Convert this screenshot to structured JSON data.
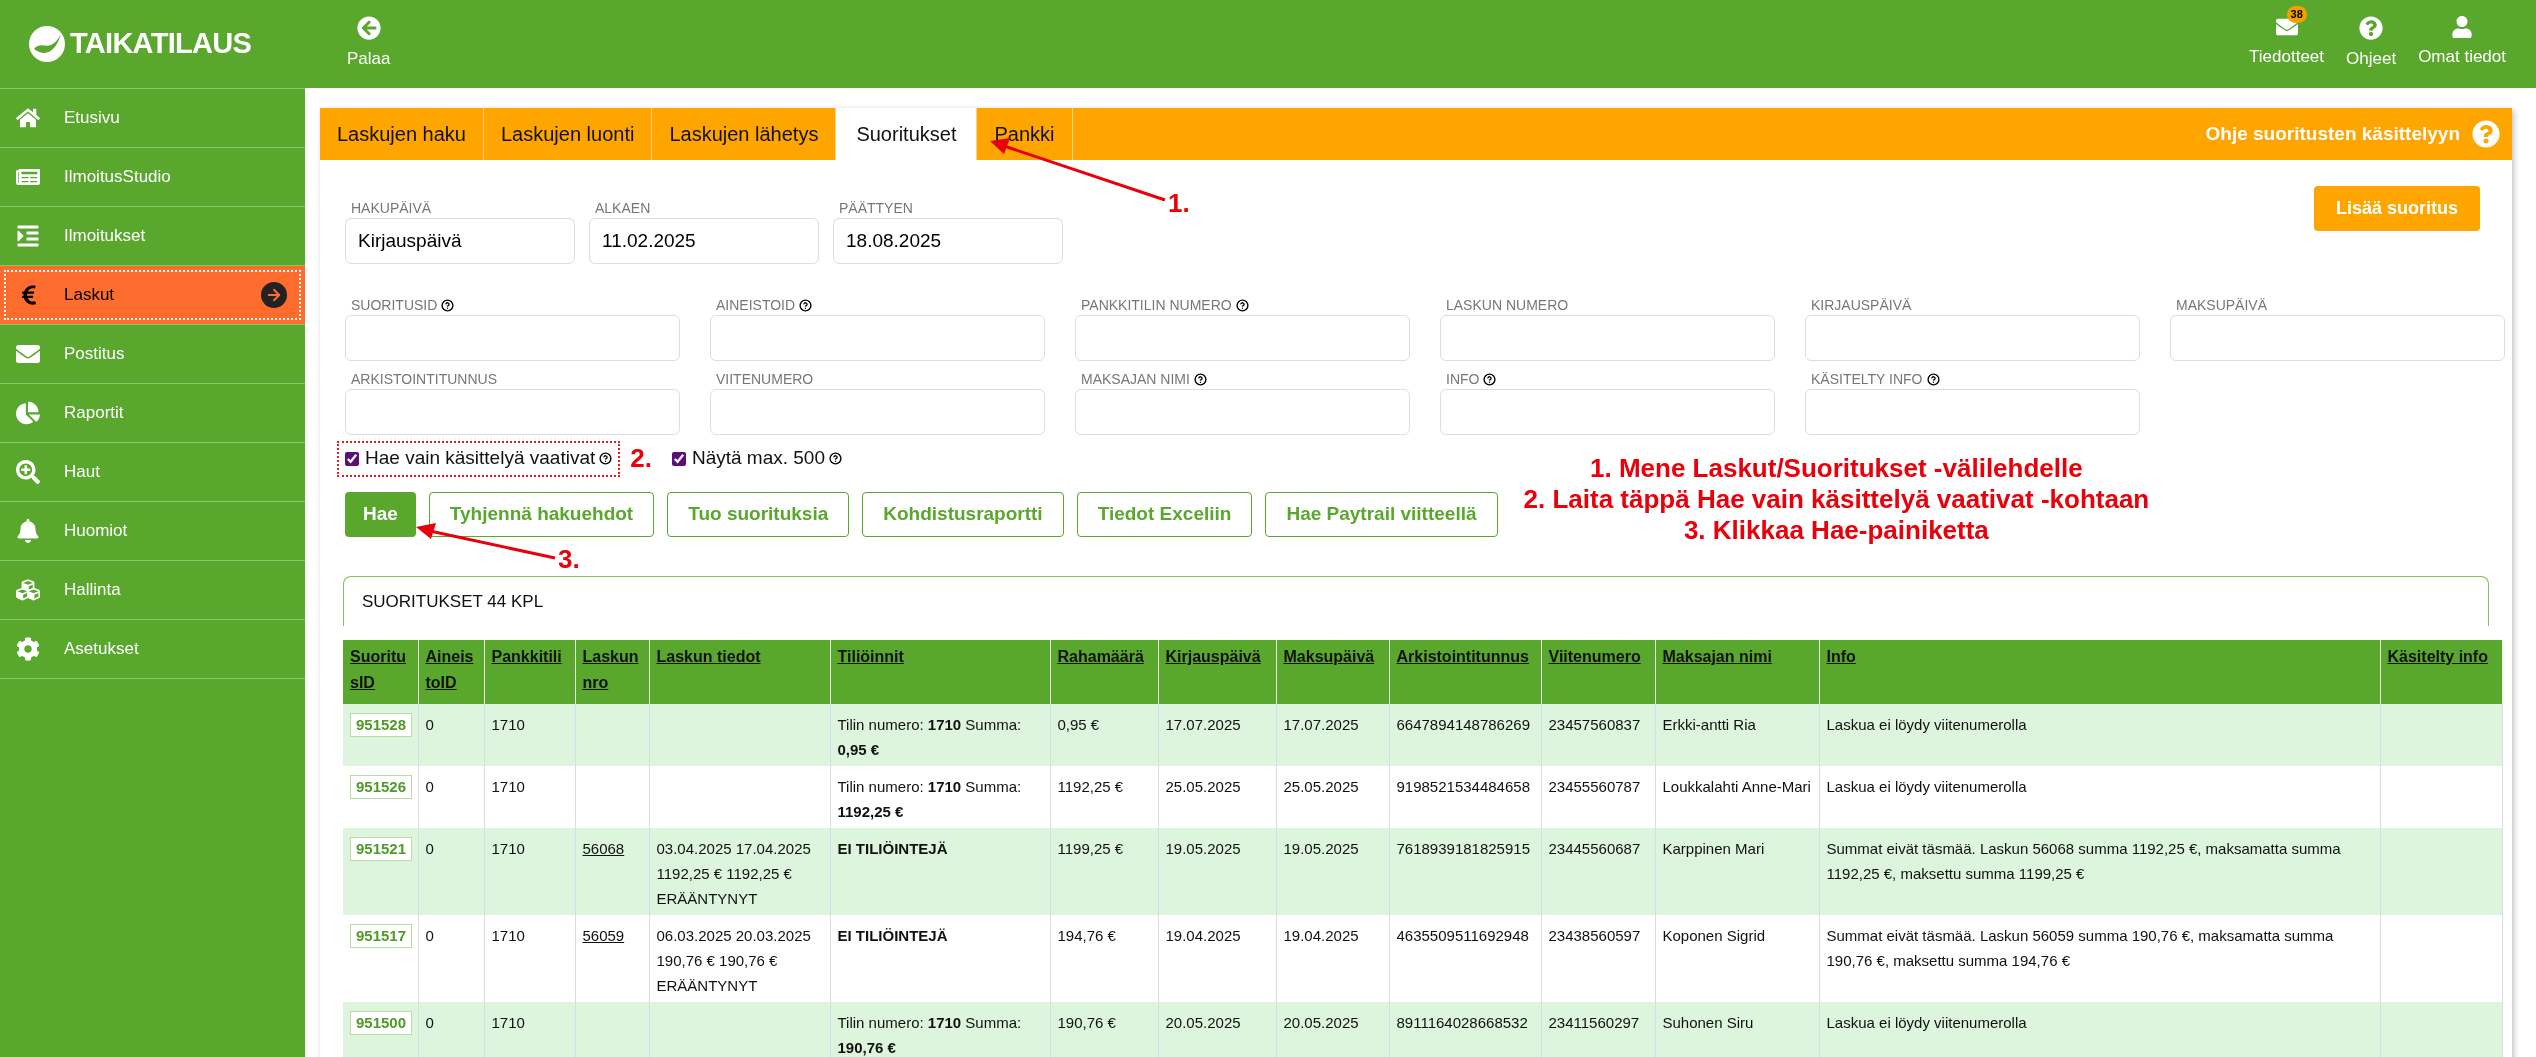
{
  "header": {
    "logo": "TAIKATILAUS",
    "back": "Palaa",
    "nav": [
      {
        "label": "Tiedotteet",
        "badge": "38"
      },
      {
        "label": "Ohjeet"
      },
      {
        "label": "Omat tiedot"
      }
    ]
  },
  "sidebar": {
    "items": [
      {
        "label": "Etusivu",
        "selected": false
      },
      {
        "label": "IlmoitusStudio",
        "selected": false
      },
      {
        "label": "Ilmoitukset",
        "selected": false
      },
      {
        "label": "Laskut",
        "selected": true
      },
      {
        "label": "Postitus",
        "selected": false
      },
      {
        "label": "Raportit",
        "selected": false
      },
      {
        "label": "Haut",
        "selected": false
      },
      {
        "label": "Huomiot",
        "selected": false
      },
      {
        "label": "Hallinta",
        "selected": false
      },
      {
        "label": "Asetukset",
        "selected": false
      }
    ]
  },
  "tabs": [
    {
      "label": "Laskujen haku",
      "selected": false
    },
    {
      "label": "Laskujen luonti",
      "selected": false
    },
    {
      "label": "Laskujen lähetys",
      "selected": false
    },
    {
      "label": "Suoritukset",
      "selected": true
    },
    {
      "label": "Pankki",
      "selected": false
    }
  ],
  "help_link": "Ohje suoritusten käsittelyyn",
  "date_fields": [
    {
      "label": "HAKUPÄIVÄ",
      "value": "Kirjauspäivä"
    },
    {
      "label": "ALKAEN",
      "value": "11.02.2025"
    },
    {
      "label": "PÄÄTTYEN",
      "value": "18.08.2025"
    }
  ],
  "add_button": "Lisää suoritus",
  "filters": [
    {
      "label": "SUORITUSID",
      "help": true
    },
    {
      "label": "AINEISTOID",
      "help": true
    },
    {
      "label": "PANKKITILIN NUMERO",
      "help": true
    },
    {
      "label": "LASKUN NUMERO",
      "help": false
    },
    {
      "label": "KIRJAUSPÄIVÄ",
      "help": false
    },
    {
      "label": "MAKSUPÄIVÄ",
      "help": false
    },
    {
      "label": "ARKISTOINTITUNNUS",
      "help": false
    },
    {
      "label": "VIITENUMERO",
      "help": false
    },
    {
      "label": "MAKSAJAN NIMI",
      "help": true
    },
    {
      "label": "INFO",
      "help": true
    },
    {
      "label": "KÄSITELTY INFO",
      "help": true
    }
  ],
  "checkboxes": [
    {
      "label": "Hae vain käsittelyä vaativat",
      "checked": true,
      "help": true,
      "highlighted": true
    },
    {
      "label": "Näytä max. 500",
      "checked": true,
      "help": true,
      "highlighted": false
    }
  ],
  "buttons": [
    {
      "label": "Hae",
      "kind": "primary"
    },
    {
      "label": "Tyhjennä hakuehdot",
      "kind": "outline"
    },
    {
      "label": "Tuo suorituksia",
      "kind": "outline"
    },
    {
      "label": "Kohdistusraportti",
      "kind": "outline"
    },
    {
      "label": "Tiedot Exceliin",
      "kind": "outline"
    },
    {
      "label": "Hae Paytrail viitteellä",
      "kind": "outline"
    }
  ],
  "annotations": {
    "markers": [
      "1.",
      "2.",
      "3."
    ],
    "steps": [
      "1. Mene Laskut/Suoritukset -välilehdelle",
      "2. Laita täppä Hae vain käsittelyä vaativat -kohtaan",
      "3. Klikkaa Hae-painiketta"
    ]
  },
  "table": {
    "title": "SUORITUKSET 44 KPL",
    "columns": [
      "SuoritusID",
      "AineistoID",
      "Pankkitili",
      "Laskun nro",
      "Laskun tiedot",
      "Tiliöinnit",
      "Rahamäärä",
      "Kirjauspäivä",
      "Maksupäivä",
      "Arkistointitunnus",
      "Viitenumero",
      "Maksajan nimi",
      "Info",
      "Käsitelty info"
    ],
    "rows": [
      {
        "suoritusid": "951528",
        "aineistoid": "0",
        "pankkitili": "1710",
        "tilioinnit": {
          "kind": "entry",
          "text": "Tilin numero: **1710** Summa: **0,95 €**"
        },
        "rahamaara": "0,95 €",
        "kirjauspaiva": "17.07.2025",
        "maksupaiva": "17.07.2025",
        "arkistointitunnus": "6647894148786269",
        "viitenumero": "23457560837",
        "maksaja": "Erkki-antti Ria",
        "info": "Laskua ei löydy viitenumerolla"
      },
      {
        "suoritusid": "951526",
        "aineistoid": "0",
        "pankkitili": "1710",
        "tilioinnit": {
          "kind": "entry",
          "text": "Tilin numero: **1710** Summa: **1192,25 €**"
        },
        "rahamaara": "1192,25 €",
        "kirjauspaiva": "25.05.2025",
        "maksupaiva": "25.05.2025",
        "arkistointitunnus": "9198521534484658",
        "viitenumero": "23455560787",
        "maksaja": "Loukkalahti Anne-Mari",
        "info": "Laskua ei löydy viitenumerolla"
      },
      {
        "suoritusid": "951521",
        "aineistoid": "0",
        "pankkitili": "1710",
        "laskun_nro": "56068",
        "laskun_tiedot": "03.04.2025 17.04.2025 1192,25 € 1192,25 € ERÄÄNTYNYT",
        "tilioinnit": {
          "kind": "none",
          "text": "EI TILIÖINTEJÄ"
        },
        "rahamaara": "1199,25 €",
        "kirjauspaiva": "19.05.2025",
        "maksupaiva": "19.05.2025",
        "arkistointitunnus": "7618939181825915",
        "viitenumero": "23445560687",
        "maksaja": "Karppinen Mari",
        "info": "Summat eivät täsmää. Laskun 56068 summa 1192,25 €, maksamatta summa 1192,25 €, maksettu summa 1199,25 €"
      },
      {
        "suoritusid": "951517",
        "aineistoid": "0",
        "pankkitili": "1710",
        "laskun_nro": "56059",
        "laskun_tiedot": "06.03.2025 20.03.2025 190,76 € 190,76 € ERÄÄNTYNYT",
        "tilioinnit": {
          "kind": "none",
          "text": "EI TILIÖINTEJÄ"
        },
        "rahamaara": "194,76 €",
        "kirjauspaiva": "19.04.2025",
        "maksupaiva": "19.04.2025",
        "arkistointitunnus": "4635509511692948",
        "viitenumero": "23438560597",
        "maksaja": "Koponen Sigrid",
        "info": "Summat eivät täsmää. Laskun 56059 summa 190,76 €, maksamatta summa 190,76 €, maksettu summa 194,76 €"
      },
      {
        "suoritusid": "951500",
        "aineistoid": "0",
        "pankkitili": "1710",
        "tilioinnit": {
          "kind": "entry",
          "text": "Tilin numero: **1710** Summa: **190,76 €**"
        },
        "rahamaara": "190,76 €",
        "kirjauspaiva": "20.05.2025",
        "maksupaiva": "20.05.2025",
        "arkistointitunnus": "8911164028668532",
        "viitenumero": "23411560297",
        "maksaja": "Suhonen Siru",
        "info": "Laskua ei löydy viitenumerolla"
      }
    ]
  }
}
